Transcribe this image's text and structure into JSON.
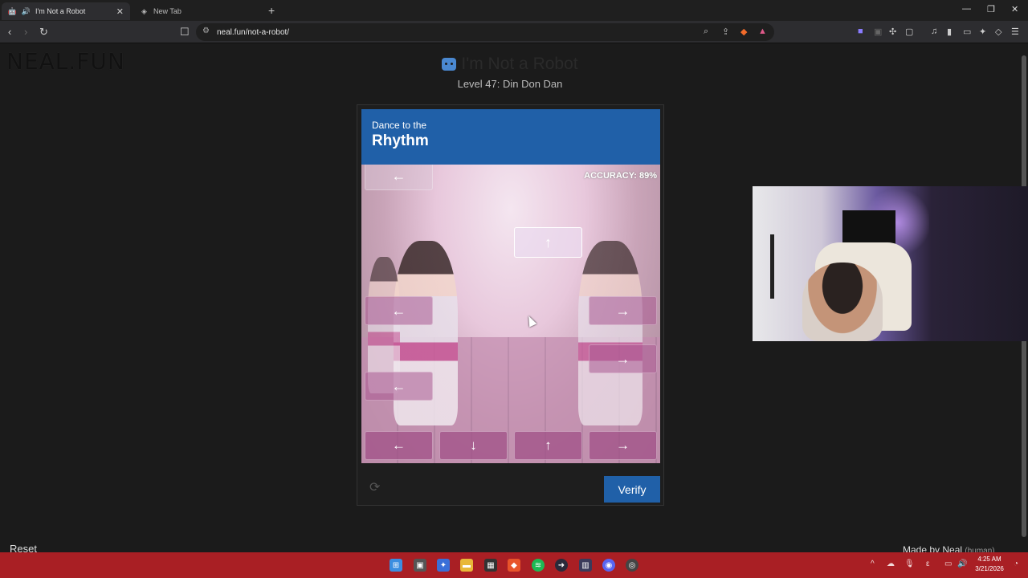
{
  "browser": {
    "tabs": [
      {
        "label": "I'm Not a Robot",
        "active": true
      },
      {
        "label": "New Tab",
        "active": false
      }
    ],
    "url": "neal.fun/not-a-robot/"
  },
  "site": {
    "logo": "NEAL.FUN",
    "title": "I'm Not a Robot",
    "level": "Level 47: Din Don Dan"
  },
  "captcha": {
    "instruction_small": "Dance to the",
    "instruction_big": "Rhythm",
    "accuracy": "ACCURACY: 89%",
    "falling_notes": [
      "←",
      "↑",
      "←",
      "→",
      "→",
      "←"
    ],
    "targets": [
      "←",
      "↓",
      "↑",
      "→"
    ],
    "verify_label": "Verify",
    "reload_icon": "refresh-icon"
  },
  "footer": {
    "reset": "Reset",
    "made_by": "Made by Neal",
    "made_by_note": "(human)"
  },
  "taskbar": {
    "time": "4:25 AM",
    "date": "3/21/2026"
  },
  "colors": {
    "accent_blue": "#2060a8",
    "taskbar_red": "#a91f24",
    "note_pink": "#a05087"
  }
}
